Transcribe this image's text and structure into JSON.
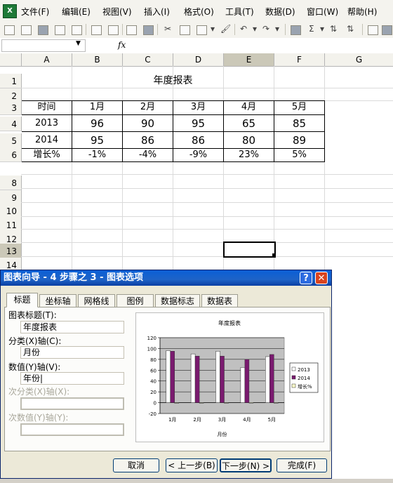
{
  "menu": [
    "文件(F)",
    "编辑(E)",
    "视图(V)",
    "插入(I)",
    "格式(O)",
    "工具(T)",
    "数据(D)",
    "窗口(W)",
    "帮助(H)"
  ],
  "formula": {
    "fx": "fx"
  },
  "columns": [
    "A",
    "B",
    "C",
    "D",
    "E",
    "F",
    "G"
  ],
  "rows": [
    "1",
    "2",
    "3",
    "4",
    "5",
    "6",
    "7",
    "8",
    "9",
    "10",
    "11",
    "12",
    "13",
    "14"
  ],
  "sheet": {
    "title": "年度报表",
    "header": [
      "时间",
      "1月",
      "2月",
      "3月",
      "4月",
      "5月"
    ],
    "rows": [
      [
        "2013",
        "96",
        "90",
        "95",
        "65",
        "85"
      ],
      [
        "2014",
        "95",
        "86",
        "86",
        "80",
        "89"
      ],
      [
        "增长%",
        "-1%",
        "-4%",
        "-9%",
        "23%",
        "5%"
      ]
    ]
  },
  "dialog": {
    "title": "图表向导 - 4 步骤之 3 - 图表选项",
    "help": "?",
    "close": "✕",
    "tabs": [
      "标题",
      "坐标轴",
      "网格线",
      "图例",
      "数据标志",
      "数据表"
    ],
    "fields": [
      {
        "label": "图表标题(T):",
        "value": "年度报表"
      },
      {
        "label": "分类(X)轴(C):",
        "value": "月份"
      },
      {
        "label": "数值(Y)轴(V):",
        "value": "年份|"
      },
      {
        "label": "次分类(X)轴(X):",
        "value": ""
      },
      {
        "label": "次数值(Y)轴(Y):",
        "value": ""
      }
    ],
    "buttons": [
      "取消",
      "< 上一步(B)",
      "下一步(N) >",
      "完成(F)"
    ]
  },
  "chart_data": {
    "type": "bar",
    "title": "年度报表",
    "xlabel": "月份",
    "ylabel": "年份",
    "categories": [
      "1月",
      "2月",
      "3月",
      "4月",
      "5月"
    ],
    "series": [
      {
        "name": "2013",
        "values": [
          96,
          90,
          95,
          65,
          85
        ],
        "color": "#ffffff"
      },
      {
        "name": "2014",
        "values": [
          95,
          86,
          86,
          80,
          89
        ],
        "color": "#7a1a6f"
      },
      {
        "name": "增长%",
        "values": [
          -0.01,
          -0.04,
          -0.09,
          0.23,
          0.05
        ],
        "color": "#ffffcc"
      }
    ],
    "ylim": [
      -20,
      120
    ],
    "yticks": [
      "120",
      "100",
      "80",
      "60",
      "40",
      "20",
      "0",
      "-20"
    ],
    "plot_background": "#c0c0c0",
    "legend": "right",
    "grid": true
  }
}
